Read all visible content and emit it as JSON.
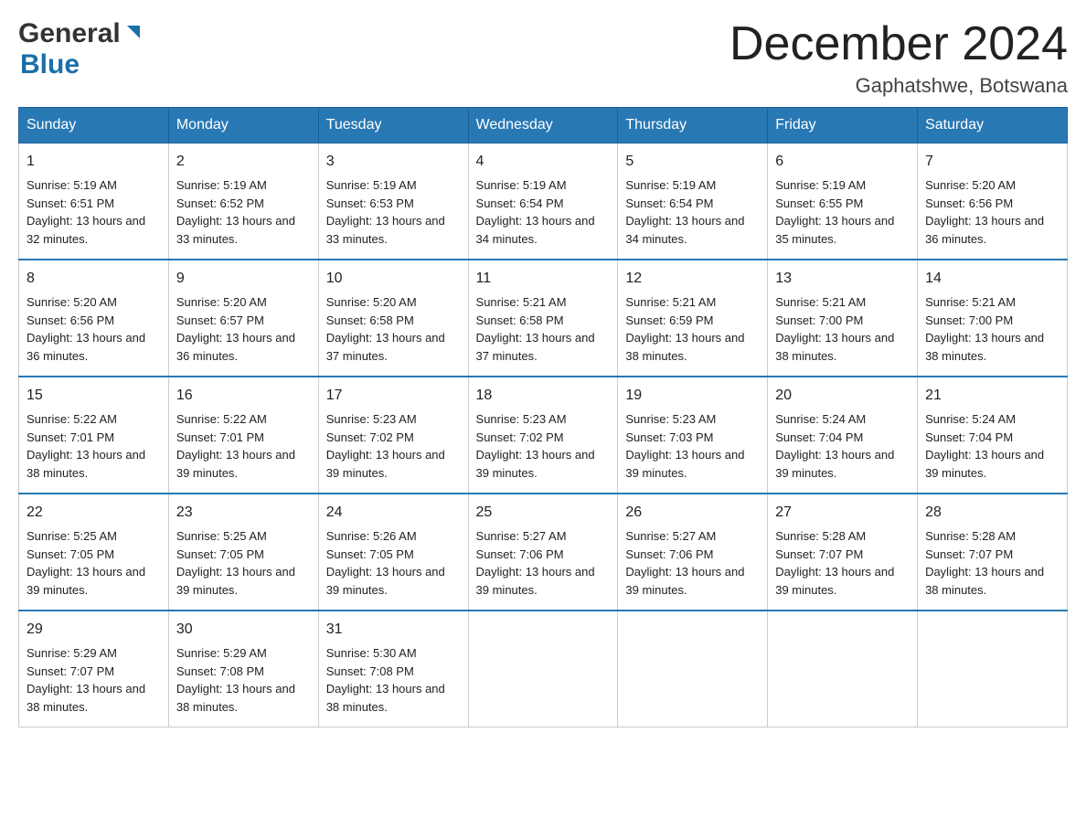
{
  "header": {
    "logo_general": "General",
    "logo_blue": "Blue",
    "title": "December 2024",
    "location": "Gaphatshwe, Botswana"
  },
  "days_of_week": [
    "Sunday",
    "Monday",
    "Tuesday",
    "Wednesday",
    "Thursday",
    "Friday",
    "Saturday"
  ],
  "weeks": [
    [
      {
        "day": "1",
        "sunrise": "5:19 AM",
        "sunset": "6:51 PM",
        "daylight": "13 hours and 32 minutes."
      },
      {
        "day": "2",
        "sunrise": "5:19 AM",
        "sunset": "6:52 PM",
        "daylight": "13 hours and 33 minutes."
      },
      {
        "day": "3",
        "sunrise": "5:19 AM",
        "sunset": "6:53 PM",
        "daylight": "13 hours and 33 minutes."
      },
      {
        "day": "4",
        "sunrise": "5:19 AM",
        "sunset": "6:54 PM",
        "daylight": "13 hours and 34 minutes."
      },
      {
        "day": "5",
        "sunrise": "5:19 AM",
        "sunset": "6:54 PM",
        "daylight": "13 hours and 34 minutes."
      },
      {
        "day": "6",
        "sunrise": "5:19 AM",
        "sunset": "6:55 PM",
        "daylight": "13 hours and 35 minutes."
      },
      {
        "day": "7",
        "sunrise": "5:20 AM",
        "sunset": "6:56 PM",
        "daylight": "13 hours and 36 minutes."
      }
    ],
    [
      {
        "day": "8",
        "sunrise": "5:20 AM",
        "sunset": "6:56 PM",
        "daylight": "13 hours and 36 minutes."
      },
      {
        "day": "9",
        "sunrise": "5:20 AM",
        "sunset": "6:57 PM",
        "daylight": "13 hours and 36 minutes."
      },
      {
        "day": "10",
        "sunrise": "5:20 AM",
        "sunset": "6:58 PM",
        "daylight": "13 hours and 37 minutes."
      },
      {
        "day": "11",
        "sunrise": "5:21 AM",
        "sunset": "6:58 PM",
        "daylight": "13 hours and 37 minutes."
      },
      {
        "day": "12",
        "sunrise": "5:21 AM",
        "sunset": "6:59 PM",
        "daylight": "13 hours and 38 minutes."
      },
      {
        "day": "13",
        "sunrise": "5:21 AM",
        "sunset": "7:00 PM",
        "daylight": "13 hours and 38 minutes."
      },
      {
        "day": "14",
        "sunrise": "5:21 AM",
        "sunset": "7:00 PM",
        "daylight": "13 hours and 38 minutes."
      }
    ],
    [
      {
        "day": "15",
        "sunrise": "5:22 AM",
        "sunset": "7:01 PM",
        "daylight": "13 hours and 38 minutes."
      },
      {
        "day": "16",
        "sunrise": "5:22 AM",
        "sunset": "7:01 PM",
        "daylight": "13 hours and 39 minutes."
      },
      {
        "day": "17",
        "sunrise": "5:23 AM",
        "sunset": "7:02 PM",
        "daylight": "13 hours and 39 minutes."
      },
      {
        "day": "18",
        "sunrise": "5:23 AM",
        "sunset": "7:02 PM",
        "daylight": "13 hours and 39 minutes."
      },
      {
        "day": "19",
        "sunrise": "5:23 AM",
        "sunset": "7:03 PM",
        "daylight": "13 hours and 39 minutes."
      },
      {
        "day": "20",
        "sunrise": "5:24 AM",
        "sunset": "7:04 PM",
        "daylight": "13 hours and 39 minutes."
      },
      {
        "day": "21",
        "sunrise": "5:24 AM",
        "sunset": "7:04 PM",
        "daylight": "13 hours and 39 minutes."
      }
    ],
    [
      {
        "day": "22",
        "sunrise": "5:25 AM",
        "sunset": "7:05 PM",
        "daylight": "13 hours and 39 minutes."
      },
      {
        "day": "23",
        "sunrise": "5:25 AM",
        "sunset": "7:05 PM",
        "daylight": "13 hours and 39 minutes."
      },
      {
        "day": "24",
        "sunrise": "5:26 AM",
        "sunset": "7:05 PM",
        "daylight": "13 hours and 39 minutes."
      },
      {
        "day": "25",
        "sunrise": "5:27 AM",
        "sunset": "7:06 PM",
        "daylight": "13 hours and 39 minutes."
      },
      {
        "day": "26",
        "sunrise": "5:27 AM",
        "sunset": "7:06 PM",
        "daylight": "13 hours and 39 minutes."
      },
      {
        "day": "27",
        "sunrise": "5:28 AM",
        "sunset": "7:07 PM",
        "daylight": "13 hours and 39 minutes."
      },
      {
        "day": "28",
        "sunrise": "5:28 AM",
        "sunset": "7:07 PM",
        "daylight": "13 hours and 38 minutes."
      }
    ],
    [
      {
        "day": "29",
        "sunrise": "5:29 AM",
        "sunset": "7:07 PM",
        "daylight": "13 hours and 38 minutes."
      },
      {
        "day": "30",
        "sunrise": "5:29 AM",
        "sunset": "7:08 PM",
        "daylight": "13 hours and 38 minutes."
      },
      {
        "day": "31",
        "sunrise": "5:30 AM",
        "sunset": "7:08 PM",
        "daylight": "13 hours and 38 minutes."
      },
      null,
      null,
      null,
      null
    ]
  ],
  "labels": {
    "sunrise_prefix": "Sunrise: ",
    "sunset_prefix": "Sunset: ",
    "daylight_prefix": "Daylight: "
  }
}
